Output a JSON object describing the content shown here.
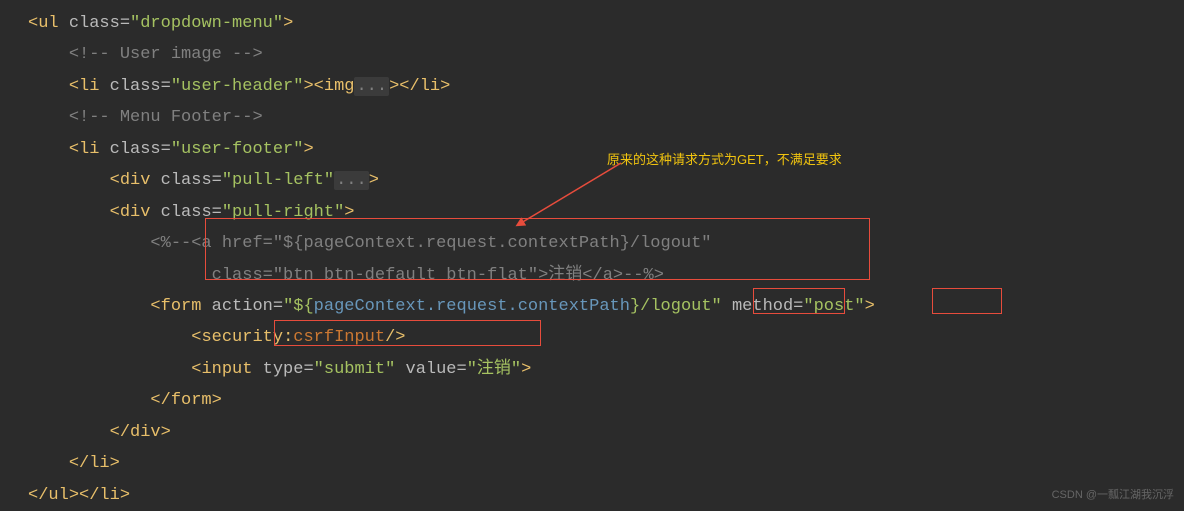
{
  "lines": {
    "l1_open": "<",
    "l1_tag": "ul ",
    "l1_attr": "class=",
    "l1_val": "\"dropdown-menu\"",
    "l1_close": ">",
    "l2": "<!-- User image -->",
    "l3_t1": "<",
    "l3_t2": "li ",
    "l3_a1": "class=",
    "l3_v1": "\"user-header\"",
    "l3_c1": ">",
    "l3_t3": "<",
    "l3_t4": "img",
    "l3_fold": "...",
    "l3_c2": ">",
    "l3_t5": "</",
    "l3_t6": "li",
    "l3_c3": ">",
    "l4": "<!-- Menu Footer-->",
    "l5_t1": "<",
    "l5_t2": "li ",
    "l5_a1": "class=",
    "l5_v1": "\"user-footer\"",
    "l5_c1": ">",
    "l6_t1": "<",
    "l6_t2": "div ",
    "l6_a1": "class=",
    "l6_v1": "\"pull-left\"",
    "l6_fold": "...",
    "l6_c1": ">",
    "l7_t1": "<",
    "l7_t2": "div ",
    "l7_a1": "class=",
    "l7_v1": "\"pull-right\"",
    "l7_c1": ">",
    "l8": "<%--<a href=\"${pageContext.request.contextPath}/logout\"",
    "l9": "   class=\"btn btn-default btn-flat\">注销</a>--%>",
    "l10_t1": "<",
    "l10_t2": "form ",
    "l10_a1": "action=",
    "l10_v1a": "\"",
    "l10_v1b": "${",
    "l10_v1c": "pageContext.request.contextPath",
    "l10_v1d": "}",
    "l10_v1e": "/logout\" ",
    "l10_a2": "method=",
    "l10_v2": "\"post\"",
    "l10_c1": ">",
    "l11_t1": "<",
    "l11_ns": "security",
    "l11_colon": ":",
    "l11_tag": "csrfInput",
    "l11_c1": "/>",
    "l12_t1": "<",
    "l12_t2": "input ",
    "l12_a1": "type=",
    "l12_v1": "\"submit\" ",
    "l12_a2": "value=",
    "l12_v2": "\"注销\"",
    "l12_c1": ">",
    "l13_t1": "</",
    "l13_t2": "form",
    "l13_c1": ">",
    "l14_t1": "</",
    "l14_t2": "div",
    "l14_c1": ">",
    "l15_t1": "</",
    "l15_t2": "li",
    "l15_c1": ">",
    "l16_t1": "</",
    "l16_t2": "ul",
    "l16_c1": ">",
    "l16_t3": "</",
    "l16_t4": "li",
    "l16_c2": ">"
  },
  "annotation": "原来的这种请求方式为GET，不满足要求",
  "watermark": "CSDN @一瓢江湖我沉浮"
}
